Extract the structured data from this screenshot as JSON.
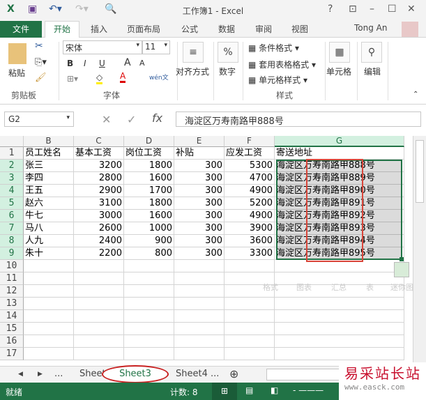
{
  "title": "工作簿1 - Excel",
  "tabs": {
    "file": "文件",
    "home": "开始",
    "items": [
      "插入",
      "页面布局",
      "公式",
      "数据",
      "审阅",
      "视图"
    ],
    "user": "Tong An"
  },
  "ribbon": {
    "clipboard": {
      "paste": "粘贴",
      "group": "剪贴板"
    },
    "font": {
      "name": "宋体",
      "size": "11",
      "bold": "B",
      "italic": "I",
      "underline": "U",
      "phonetic": "wén文",
      "group": "字体"
    },
    "alignment": "对齐方式",
    "number": "数字",
    "number_icon": "%",
    "styles": {
      "conditional": "条件格式",
      "table": "套用表格格式",
      "cell": "单元格样式",
      "group": "样式"
    },
    "cells": "单元格",
    "editing": "编辑"
  },
  "formula_bar": {
    "name_box": "G2",
    "fx": "fx",
    "value": "海淀区万寿南路甲888号"
  },
  "columns": [
    "B",
    "C",
    "D",
    "E",
    "F",
    "G"
  ],
  "rows": [
    "1",
    "2",
    "3",
    "4",
    "5",
    "6",
    "7",
    "8",
    "9",
    "10",
    "11",
    "12",
    "13",
    "14",
    "15",
    "16",
    "17"
  ],
  "headers": [
    "员工姓名",
    "基本工资",
    "岗位工资",
    "补贴",
    "应发工资",
    "寄送地址"
  ],
  "data": [
    [
      "张三",
      "3200",
      "1800",
      "300",
      "5300",
      "海淀区万寿南路甲888号"
    ],
    [
      "李四",
      "2800",
      "1600",
      "300",
      "4700",
      "海淀区万寿南路甲889号"
    ],
    [
      "王五",
      "2900",
      "1700",
      "300",
      "4900",
      "海淀区万寿南路甲890号"
    ],
    [
      "赵六",
      "3100",
      "1800",
      "300",
      "5200",
      "海淀区万寿南路甲891号"
    ],
    [
      "牛七",
      "3000",
      "1600",
      "300",
      "4900",
      "海淀区万寿南路甲892号"
    ],
    [
      "马八",
      "2600",
      "1000",
      "300",
      "3900",
      "海淀区万寿南路甲893号"
    ],
    [
      "人九",
      "2400",
      "900",
      "300",
      "3600",
      "海淀区万寿南路甲894号"
    ],
    [
      "朱十",
      "2200",
      "800",
      "300",
      "3300",
      "海淀区万寿南路甲895号"
    ]
  ],
  "quick_analysis": [
    "格式",
    "图表",
    "汇总",
    "表",
    "迷你图"
  ],
  "sheets": {
    "ellipsis": "...",
    "items": [
      "Sheet2",
      "Sheet3",
      "Sheet4"
    ],
    "active": "Sheet3"
  },
  "status": {
    "ready": "就绪",
    "count": "计数: 8"
  },
  "watermark": {
    "name": "易采站长站",
    "url": "www.easck.com"
  }
}
